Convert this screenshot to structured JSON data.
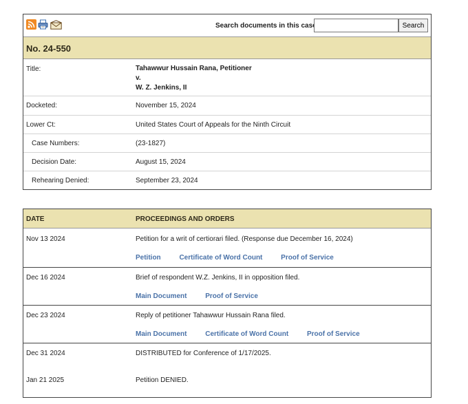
{
  "toolbar": {
    "search_label": "Search documents in this case:",
    "search_value": "",
    "search_button": "Search",
    "icons": [
      "rss-icon",
      "print-icon",
      "mail-icon"
    ]
  },
  "case": {
    "number": "No. 24-550",
    "title_label": "Title:",
    "title_line1": "Tahawwur Hussain Rana, Petitioner",
    "title_line2": "v.",
    "title_line3": "W. Z. Jenkins, II",
    "docketed_label": "Docketed:",
    "docketed_value": "November 15, 2024",
    "lower_ct_label": "Lower Ct:",
    "lower_ct_value": "United States Court of Appeals for the Ninth Circuit",
    "case_numbers_label": "Case Numbers:",
    "case_numbers_value": "(23-1827)",
    "decision_date_label": "Decision Date:",
    "decision_date_value": "August 15, 2024",
    "rehearing_label": "Rehearing Denied:",
    "rehearing_value": "September 23, 2024"
  },
  "orders": {
    "date_header": "DATE",
    "proceedings_header": "PROCEEDINGS AND ORDERS",
    "entries": [
      {
        "date": "Nov 13 2024",
        "text": "Petition for a writ of certiorari filed. (Response due December 16, 2024)",
        "links": [
          "Petition",
          "Certificate of Word Count",
          "Proof of Service"
        ]
      },
      {
        "date": "Dec 16 2024",
        "text": "Brief of respondent W.Z. Jenkins, II in opposition filed.",
        "links": [
          "Main Document",
          "Proof of Service"
        ]
      },
      {
        "date": "Dec 23 2024",
        "text": "Reply of petitioner Tahawwur Hussain Rana filed.",
        "links": [
          "Main Document",
          "Certificate of Word Count",
          "Proof of Service"
        ]
      },
      {
        "date": "Dec 31 2024",
        "text": "DISTRIBUTED for Conference of 1/17/2025.",
        "links": []
      },
      {
        "date": "Jan 21 2025",
        "text": "Petition DENIED.",
        "links": []
      }
    ]
  }
}
